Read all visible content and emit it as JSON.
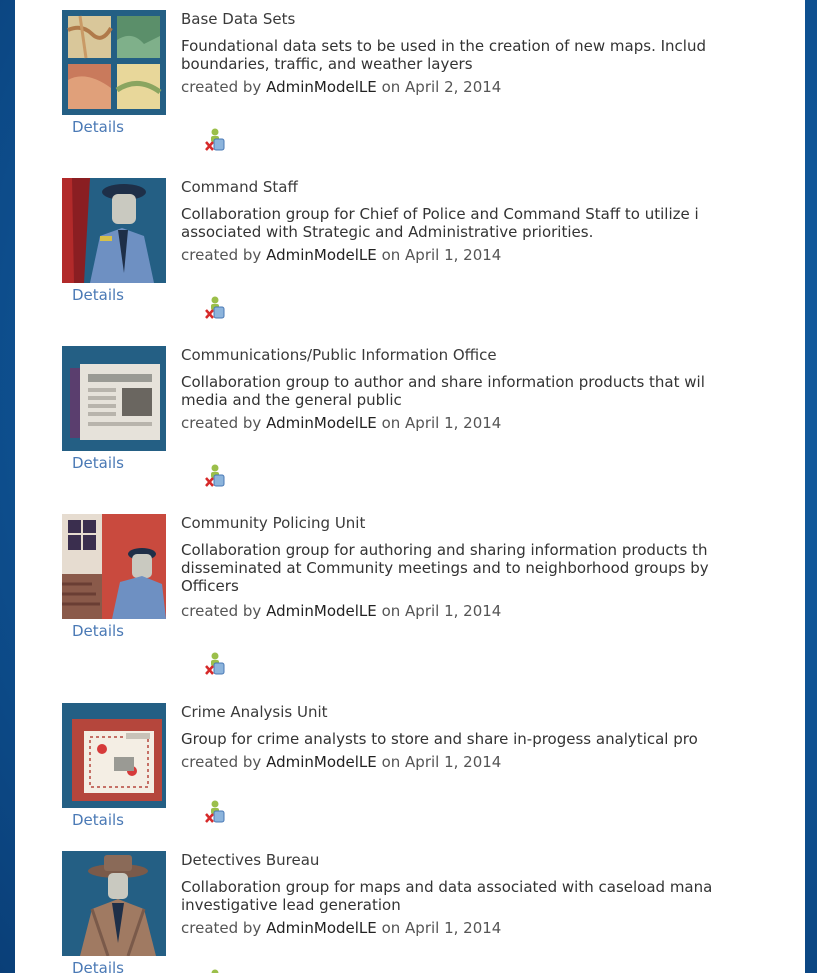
{
  "details_label": "Details",
  "created_by_label": "created by",
  "on_label": "on",
  "groups": [
    {
      "title": "Base Data Sets",
      "description": "Foundational data sets to be used in the creation of new maps. Includ\nboundaries, traffic, and weather layers",
      "owner": "AdminModelLE",
      "date": "April 2, 2014"
    },
    {
      "title": "Command Staff",
      "description": "Collaboration group for Chief of Police and Command Staff to utilize i\nassociated with Strategic and Administrative priorities.",
      "owner": "AdminModelLE",
      "date": "April 1, 2014"
    },
    {
      "title": "Communications/Public Information Office",
      "description": "Collaboration group to author and share information products that wil\nmedia and the general public",
      "owner": "AdminModelLE",
      "date": "April 1, 2014"
    },
    {
      "title": "Community Policing Unit",
      "description": "Collaboration group for authoring and sharing information products th\ndisseminated at Community meetings and to neighborhood groups by\nOfficers",
      "owner": "AdminModelLE",
      "date": "April 1, 2014"
    },
    {
      "title": "Crime Analysis Unit",
      "description": "Group for crime analysts to store and share in-progess analytical pro",
      "owner": "AdminModelLE",
      "date": "April 1, 2014"
    },
    {
      "title": "Detectives Bureau",
      "description": "Collaboration group for maps and data associated with caseload mana\ninvestigative lead generation",
      "owner": "AdminModelLE",
      "date": "April 1, 2014"
    }
  ]
}
